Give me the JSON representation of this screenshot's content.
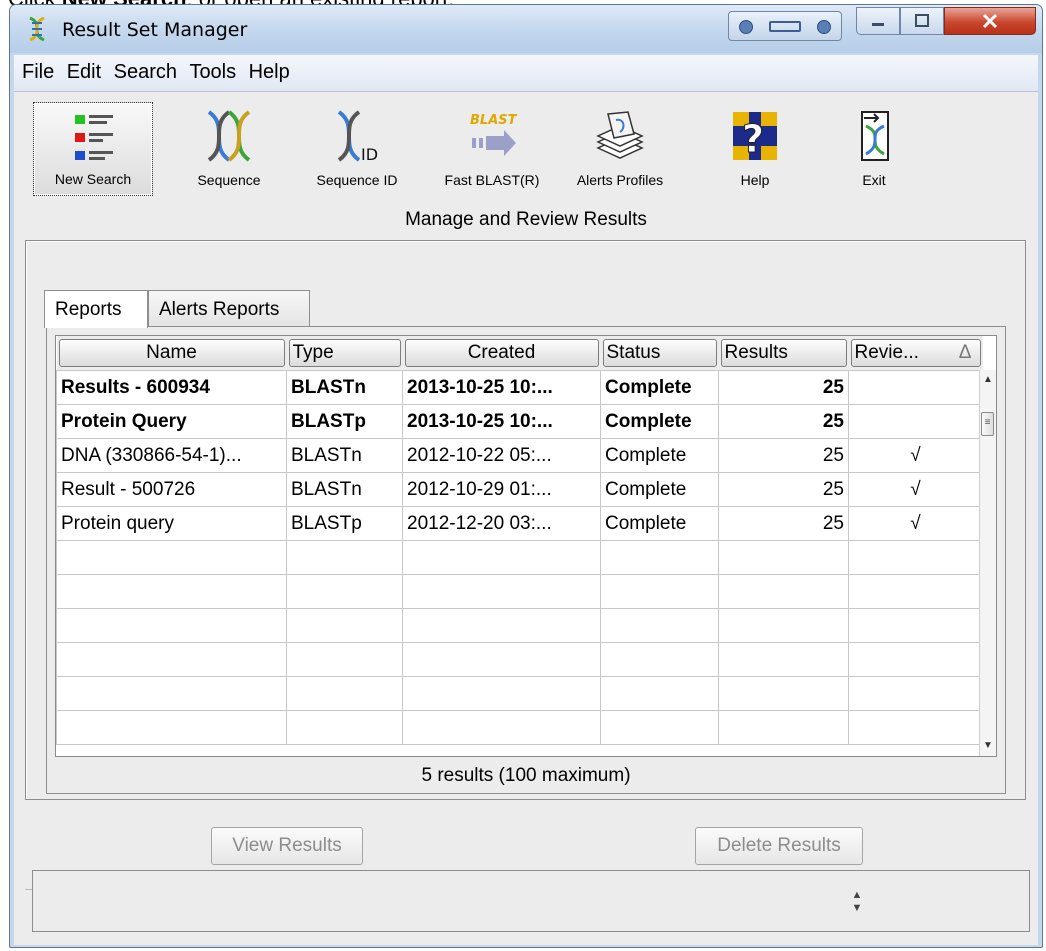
{
  "caption": {
    "prefix": "Click ",
    "bold": "New Search",
    "suffix": ", or open an existing report."
  },
  "window": {
    "title": "Result Set Manager"
  },
  "menu": [
    "File",
    "Edit",
    "Search",
    "Tools",
    "Help"
  ],
  "toolbar": {
    "new_search": "New Search",
    "sequence": "Sequence",
    "sequence_id": "Sequence ID",
    "sequence_id_icon_text": "ID",
    "fast_blast": "Fast BLAST(R)",
    "fast_blast_icon_text": "BLAST",
    "alerts_profiles": "Alerts Profiles",
    "help": "Help",
    "exit": "Exit"
  },
  "section_title": "Manage and Review Results",
  "tabs": {
    "reports": "Reports",
    "alerts_reports": "Alerts Reports"
  },
  "table": {
    "columns": [
      "Name",
      "Type",
      "Created",
      "Status",
      "Results",
      "Revie..."
    ],
    "sort_indicator": "Δ",
    "rows": [
      {
        "name": "Results - 600934",
        "type": "BLASTn",
        "created": "2013-10-25 10:...",
        "status": "Complete",
        "results": "25",
        "reviewed": ""
      },
      {
        "name": "Protein Query",
        "type": "BLASTp",
        "created": "2013-10-25 10:...",
        "status": "Complete",
        "results": "25",
        "reviewed": ""
      },
      {
        "name": "DNA (330866-54-1)...",
        "type": "BLASTn",
        "created": "2012-10-22 05:...",
        "status": "Complete",
        "results": "25",
        "reviewed": "√"
      },
      {
        "name": "Result - 500726",
        "type": "BLASTn",
        "created": "2012-10-29 01:...",
        "status": "Complete",
        "results": "25",
        "reviewed": "√"
      },
      {
        "name": "Protein query",
        "type": "BLASTp",
        "created": "2012-12-20 03:...",
        "status": "Complete",
        "results": "25",
        "reviewed": "√"
      }
    ],
    "status": "5 results (100 maximum)"
  },
  "buttons": {
    "view": "View Results",
    "delete": "Delete Results"
  },
  "colors": {
    "window_frame": "#c4d7ec",
    "close_button": "#c9472d",
    "client_bg": "#ececec",
    "disabled_text": "#8d8d8d"
  }
}
